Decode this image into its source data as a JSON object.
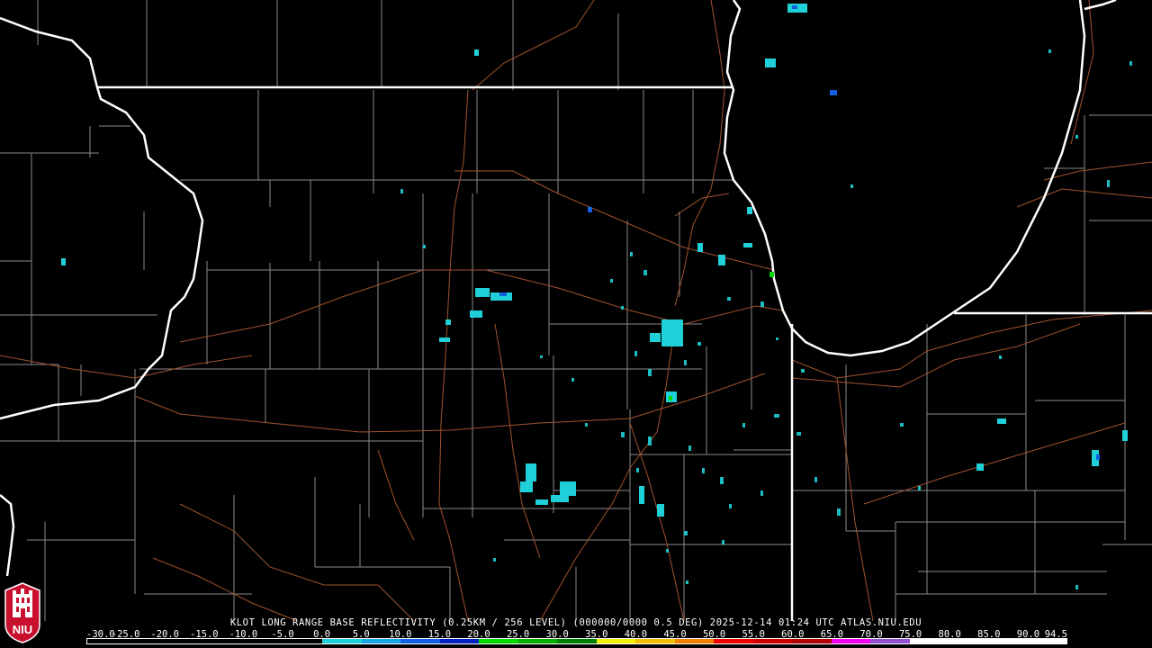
{
  "product": {
    "caption": "KLOT LONG RANGE BASE REFLECTIVITY (0.25KM / 256 LEVEL) (000000/0000 0.5 DEG) 2025-12-14 01:24 UTC  ATLAS.NIU.EDU"
  },
  "legend": {
    "ticks": [
      "-30.0",
      "-25.0",
      "-20.0",
      "-15.0",
      "-10.0",
      "-5.0",
      "0.0",
      "5.0",
      "10.0",
      "15.0",
      "20.0",
      "25.0",
      "30.0",
      "35.0",
      "40.0",
      "45.0",
      "50.0",
      "55.0",
      "60.0",
      "65.0",
      "70.0",
      "75.0",
      "80.0",
      "85.0",
      "90.0",
      "94.5"
    ],
    "colors": [
      "#000000",
      "#000000",
      "#000000",
      "#000000",
      "#000000",
      "#000000",
      "#1fd0d8",
      "#1aa7e8",
      "#1060e0",
      "#0020c0",
      "#00d800",
      "#00b000",
      "#008000",
      "#f0f000",
      "#f0c000",
      "#f08000",
      "#f00000",
      "#d00000",
      "#b00000",
      "#f000f0",
      "#9050d0",
      "#ffffff",
      "#ffffff",
      "#ffffff",
      "#ffffff"
    ]
  },
  "logo": {
    "text": "NIU"
  },
  "map": {
    "colors": {
      "state_border": "#ffffff",
      "county_line": "#8c8c8c",
      "highway": "#a0522d",
      "echo_light": "#1fd0d8",
      "echo_mid": "#1060e0",
      "echo_green": "#00d800"
    }
  }
}
